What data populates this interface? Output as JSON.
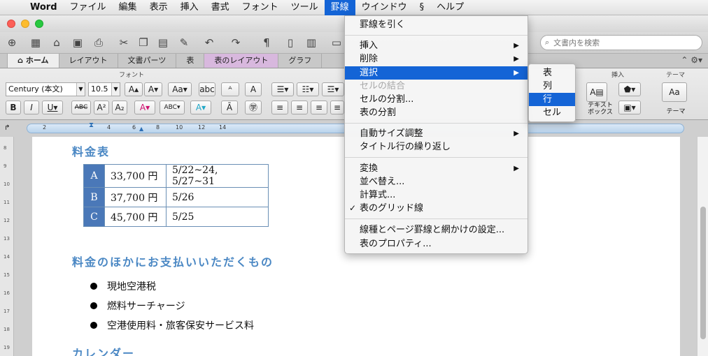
{
  "menubar": {
    "app": "Word",
    "items": [
      "ファイル",
      "編集",
      "表示",
      "挿入",
      "書式",
      "フォント",
      "ツール",
      "罫線",
      "ウインドウ",
      "ヘルプ"
    ],
    "active_index": 7
  },
  "search": {
    "placeholder": "文書内を検索"
  },
  "tabs": [
    "ホーム",
    "レイアウト",
    "文書パーツ",
    "表",
    "表のレイアウト",
    "グラフ"
  ],
  "ribbon": {
    "font_group": "フォント",
    "font_name": "Century (本文)",
    "font_size": "10.5",
    "insert_group": "挿入",
    "theme_group": "テーマ",
    "textbox_label": "テキスト\nボックス",
    "theme_label": "テーマ",
    "theme_icon_text": "Aa",
    "strike_label": "ABC",
    "abc_label": "abc",
    "a_label": "A"
  },
  "ruler": {
    "numbers": [
      "2",
      "4",
      "6",
      "8",
      "10",
      "12",
      "14"
    ]
  },
  "vruler": {
    "numbers": [
      "8",
      "9",
      "10",
      "11",
      "12",
      "13",
      "14",
      "15",
      "16",
      "17",
      "18",
      "19"
    ]
  },
  "document": {
    "heading1": "料金表",
    "table": [
      [
        "A",
        "33,700 円",
        "5/22~24, 5/27~31"
      ],
      [
        "B",
        "37,700 円",
        "5/26"
      ],
      [
        "C",
        "45,700 円",
        "5/25"
      ]
    ],
    "heading2": "料金のほかにお支払いいただくもの",
    "bullets": [
      "現地空港税",
      "燃料サーチャージ",
      "空港使用料・旅客保安サービス料"
    ],
    "heading3": "カレンダー"
  },
  "menu": {
    "items": [
      {
        "label": "罫線を引く"
      },
      {
        "label": "挿入",
        "submenu": true
      },
      {
        "label": "削除",
        "submenu": true
      },
      {
        "label": "選択",
        "submenu": true,
        "highlighted": true
      },
      {
        "label": "セルの結合",
        "disabled": true
      },
      {
        "label": "セルの分割..."
      },
      {
        "label": "表の分割"
      },
      {
        "label": "自動サイズ調整",
        "submenu": true
      },
      {
        "label": "タイトル行の繰り返し"
      },
      {
        "label": "変換",
        "submenu": true
      },
      {
        "label": "並べ替え..."
      },
      {
        "label": "計算式..."
      },
      {
        "label": "表のグリッド線",
        "checked": true
      },
      {
        "label": "線種とページ罫線と網かけの設定..."
      },
      {
        "label": "表のプロパティ..."
      }
    ]
  },
  "submenu": {
    "items": [
      "表",
      "列",
      "行",
      "セル"
    ],
    "highlighted_index": 2
  },
  "colors": {
    "accent": "#1464d6",
    "heading": "#4b88c4",
    "table_head": "#4a78b8",
    "layout_tab": "#d8b8de"
  }
}
